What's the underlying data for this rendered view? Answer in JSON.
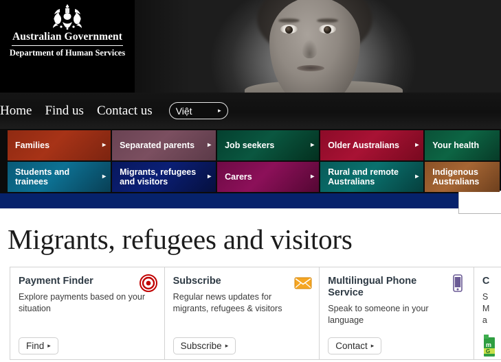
{
  "header": {
    "crest_icon": "australian-coat-of-arms",
    "government_line": "Australian Government",
    "department_line": "Department of Human Services",
    "banner_photo_alt": "black-and-white-portrait-of-child"
  },
  "topnav": {
    "links": [
      {
        "label": "Home"
      },
      {
        "label": "Find us"
      },
      {
        "label": "Contact us"
      }
    ],
    "language_button": {
      "label": "Việt",
      "caret": "▸"
    },
    "search": {
      "value": "",
      "placeholder": ""
    }
  },
  "tiles": {
    "row1": [
      {
        "label": "Families",
        "color": "#a73317"
      },
      {
        "label": "Separated parents",
        "color": "#7b4f60"
      },
      {
        "label": "Job seekers",
        "color": "#0a5740"
      },
      {
        "label": "Older Australians",
        "color": "#a81234"
      },
      {
        "label": "Your health",
        "color": "#0d6544"
      }
    ],
    "row2": [
      {
        "label": "Students and trainees",
        "color": "#0d7193"
      },
      {
        "label": "Migrants, refugees and visitors",
        "color": "#0b1f75"
      },
      {
        "label": "Carers",
        "color": "#8c1059"
      },
      {
        "label": "Rural and remote Australians",
        "color": "#0a716e"
      },
      {
        "label": "Indigenous Australians",
        "color": "#a66634"
      }
    ],
    "caret": "▸"
  },
  "divider": {
    "color": "#06226b"
  },
  "page": {
    "title": "Migrants, refugees and visitors"
  },
  "cards": [
    {
      "title": "Payment Finder",
      "description": "Explore payments based on your situation",
      "button": "Find",
      "caret": "▸",
      "icon": "target-bullseye-icon",
      "icon_color": "#c00000"
    },
    {
      "title": "Subscribe",
      "description": "Regular news updates for migrants, refugees & visitors",
      "button": "Subscribe",
      "caret": "▸",
      "icon": "envelope-icon",
      "icon_color": "#f5a623"
    },
    {
      "title": "Multilingual Phone Service",
      "description": "Speak to someone in your language",
      "button": "Contact",
      "caret": "▸",
      "icon": "mobile-phone-icon",
      "icon_color": "#6b5b95"
    },
    {
      "title": "C",
      "description_lines": [
        "S",
        "M",
        "a"
      ],
      "icon": "mygov-badge-icon",
      "icon_color": "#2f9e41"
    }
  ]
}
